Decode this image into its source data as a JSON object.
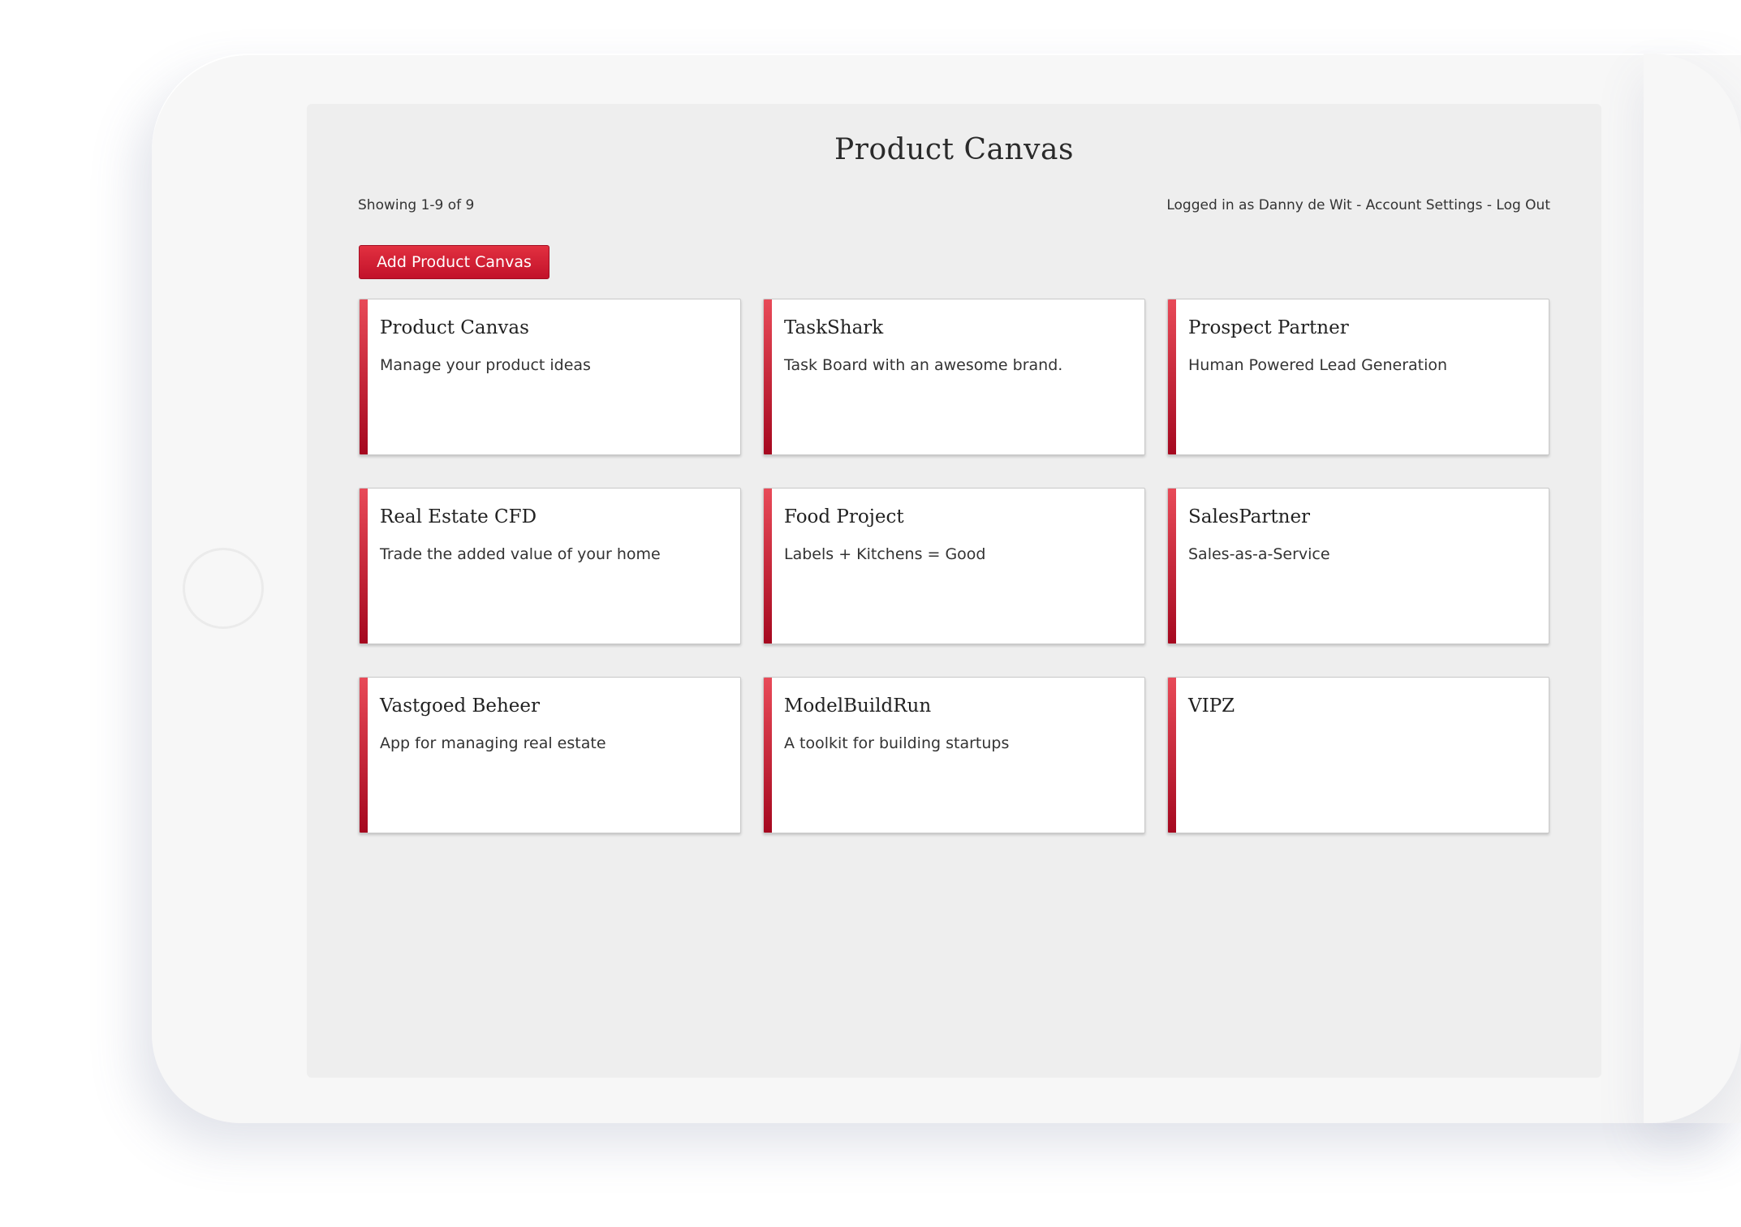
{
  "app": {
    "title": "Product Canvas"
  },
  "header": {
    "showing": "Showing 1-9 of 9",
    "logged_in_prefix": "Logged in as Danny de Wit",
    "separator": " - ",
    "account_settings": "Account Settings",
    "log_out": "Log Out"
  },
  "toolbar": {
    "add_label": "Add Product Canvas"
  },
  "colors": {
    "accent": "#c8102e",
    "screen_bg": "#eeeeee",
    "card_bg": "#ffffff"
  },
  "cards": [
    {
      "title": "Product Canvas",
      "description": "Manage your product ideas"
    },
    {
      "title": "TaskShark",
      "description": "Task Board with an awesome brand."
    },
    {
      "title": "Prospect Partner",
      "description": "Human Powered Lead Generation"
    },
    {
      "title": "Real Estate CFD",
      "description": "Trade the added value of your home"
    },
    {
      "title": "Food Project",
      "description": "Labels + Kitchens = Good"
    },
    {
      "title": "SalesPartner",
      "description": "Sales-as-a-Service"
    },
    {
      "title": "Vastgoed Beheer",
      "description": "App for managing real estate"
    },
    {
      "title": "ModelBuildRun",
      "description": "A toolkit for building startups"
    },
    {
      "title": "VIPZ",
      "description": ""
    }
  ]
}
